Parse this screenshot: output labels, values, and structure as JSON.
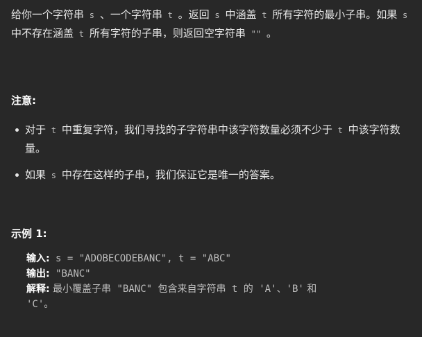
{
  "intro": {
    "part1": "给你一个字符串",
    "s": "s",
    "part2": "、一个字符串",
    "t": "t",
    "part3": "。返回",
    "part4": "中涵盖",
    "part5": "所有字符的最小子串。如果",
    "part6": "中不存在涵盖",
    "part7": "所有字符的子串，则返回空字符串",
    "empty": "\"\"",
    "part8": "。"
  },
  "notes": {
    "title": "注意:",
    "items": [
      {
        "pre": "对于",
        "code": "t",
        "mid": "中重复字符，我们寻找的子字符串中该字符数量必须不少于",
        "code2": "t",
        "post": "中该字符数量。"
      },
      {
        "pre": "如果",
        "code": "s",
        "post": "中存在这样的子串，我们保证它是唯一的答案。"
      }
    ]
  },
  "example": {
    "title": "示例 1:",
    "input_label": "输入:",
    "input_value": " s = \"ADOBECODEBANC\", t = \"ABC\"",
    "output_label": "输出:",
    "output_value": " \"BANC\"",
    "explain_label": "解释:",
    "explain_pre": " 最小覆盖子串",
    "explain_code1": " \"BANC\" ",
    "explain_mid": "包含来自字符串",
    "explain_code2": " t ",
    "explain_mid2": "的",
    "explain_code3": " 'A'",
    "explain_sep1": "、",
    "explain_code4": "'B'",
    "explain_and": " 和",
    "explain_code5": "'C'",
    "explain_end": "。"
  }
}
